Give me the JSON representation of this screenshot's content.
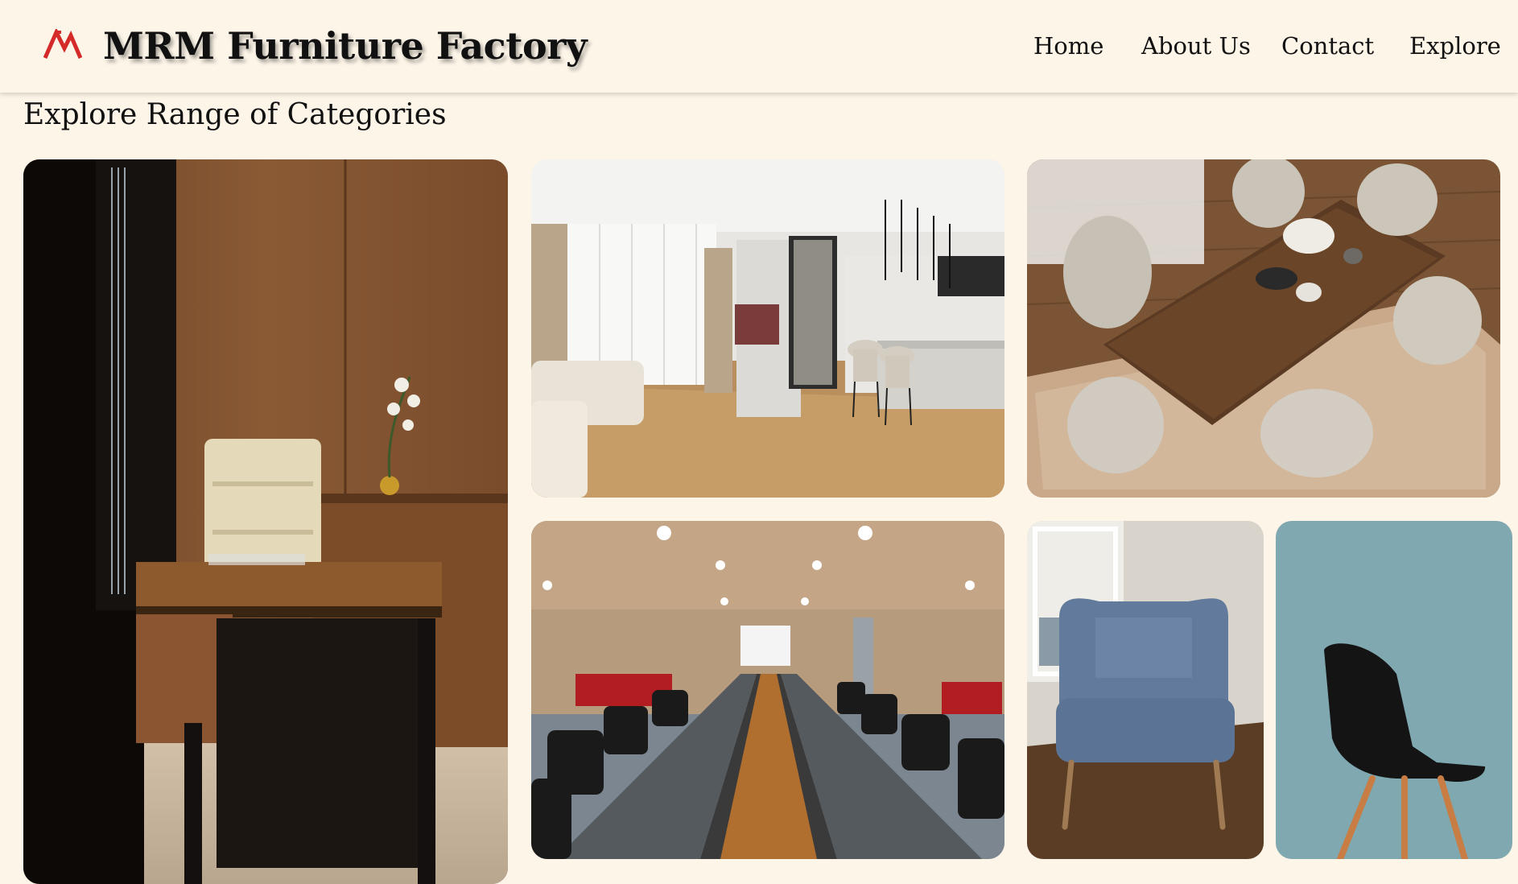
{
  "header": {
    "brand": "MRM Furniture Factory",
    "logo_icon": "mrm-logo-icon",
    "nav": [
      {
        "label": "Home"
      },
      {
        "label": "About Us"
      },
      {
        "label": "Contact"
      },
      {
        "label": "Explore"
      }
    ]
  },
  "section": {
    "title": "Explore Range of Categories"
  },
  "categories": [
    {
      "image": "office-desk-with-chair"
    },
    {
      "image": "living-room-with-kitchen"
    },
    {
      "image": "dining-table-top-view"
    },
    {
      "image": "conference-room"
    },
    {
      "image": "blue-armchair"
    },
    {
      "image": "black-chair-teal-background"
    }
  ],
  "colors": {
    "background": "#fdf5e8",
    "logo_red": "#d42a2a",
    "text": "#111111"
  }
}
